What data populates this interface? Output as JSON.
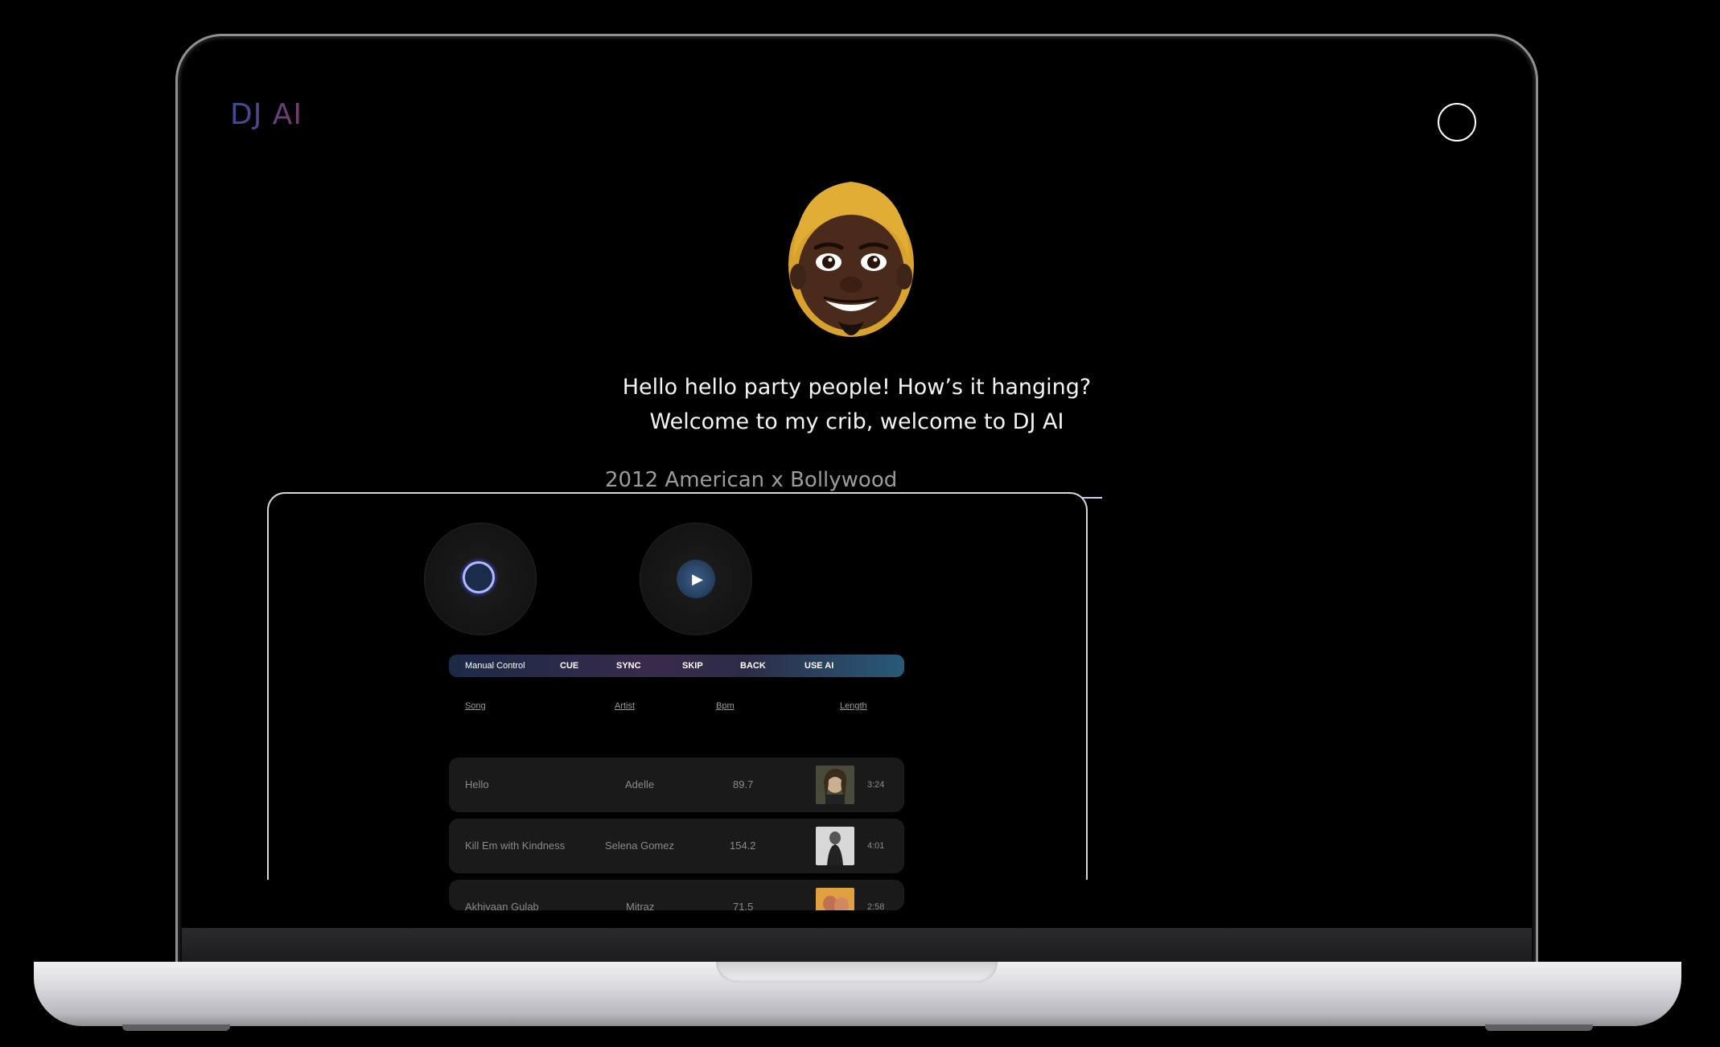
{
  "app": {
    "logo": "DJ AI"
  },
  "greeting": {
    "line1": "Hello hello party people! How’s it hanging?",
    "line2": "Welcome to my crib, welcome to DJ AI"
  },
  "search": {
    "value": "2012 American x Bollywood"
  },
  "toolbar": {
    "manual_control": "Manual Control",
    "cue": "CUE",
    "sync": "SYNC",
    "skip": "SKIP",
    "back": "BACK",
    "use_ai": "USE AI"
  },
  "table": {
    "headers": {
      "song": "Song",
      "artist": "Artist",
      "bpm": "Bpm",
      "length": "Length"
    },
    "rows": [
      {
        "song": "Hello",
        "artist": "Adelle",
        "bpm": "89.7",
        "length": "3:24"
      },
      {
        "song": "Kill Em with Kindness",
        "artist": "Selena Gomez",
        "bpm": "154.2",
        "length": "4:01"
      },
      {
        "song": "Akhiyaan Gulab",
        "artist": "Mitraz",
        "bpm": "71.5",
        "length": "2:58"
      }
    ]
  },
  "icons": {
    "avatar": "memoji-avatar",
    "profile": "profile-circle-icon",
    "deck_a": "spinning-vinyl-icon",
    "deck_b": "play-icon"
  },
  "colors": {
    "logo_gradient_start": "#3a4c9a",
    "logo_gradient_end": "#7a3a6a",
    "toolbar_end": "#285a78",
    "row_bg": "#1a1a1a"
  }
}
